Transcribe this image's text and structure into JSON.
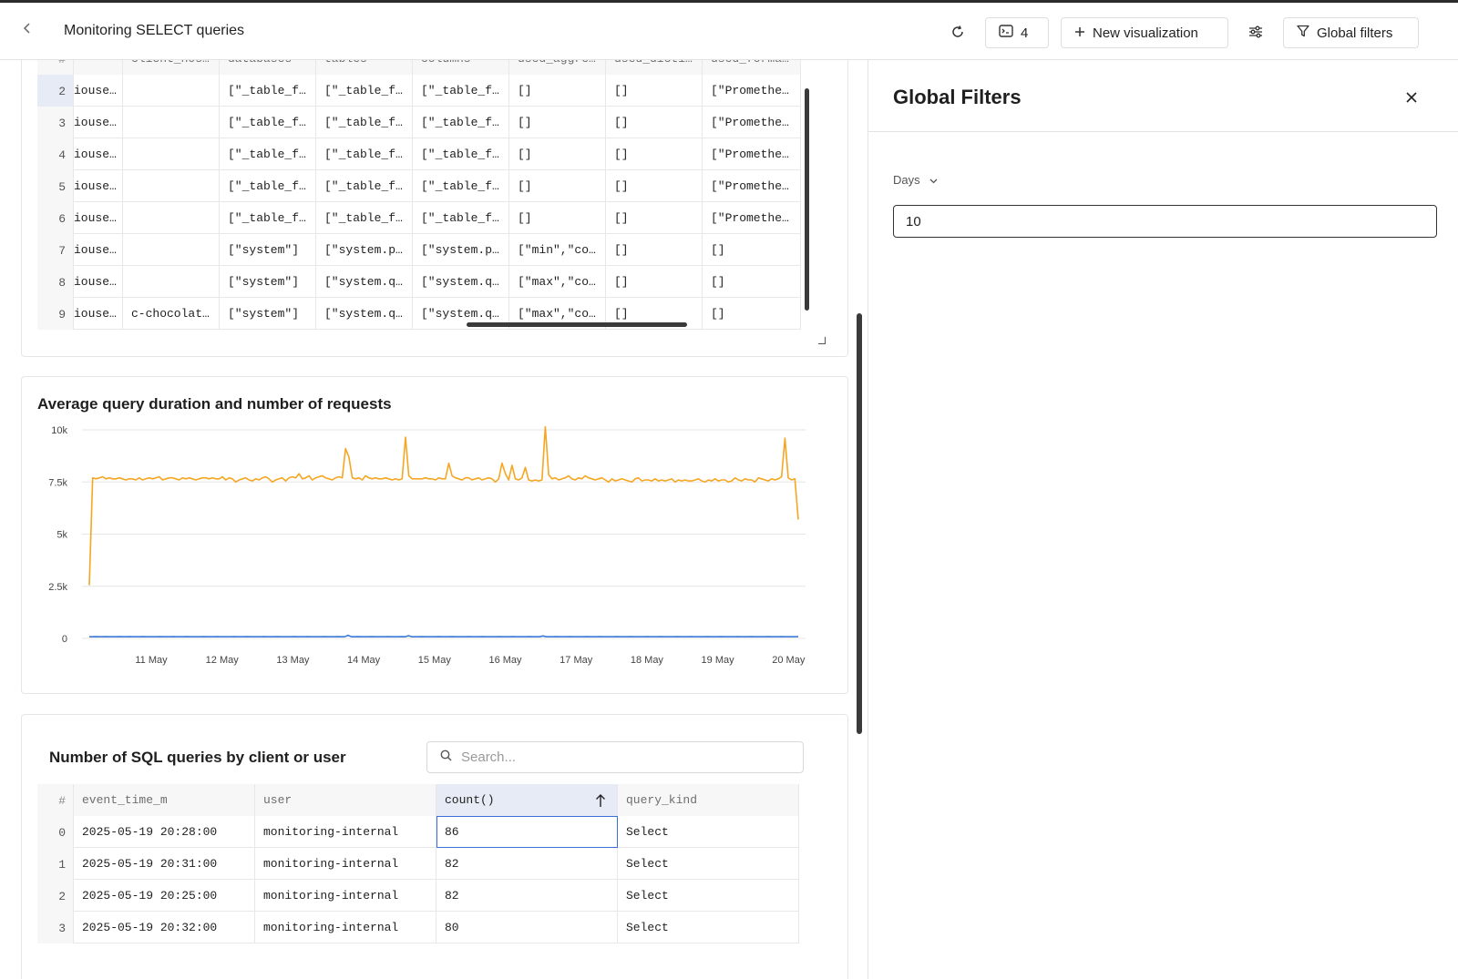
{
  "header": {
    "title": "Monitoring SELECT queries",
    "terminal_count": "4",
    "new_visualization_label": "New visualization",
    "global_filters_label": "Global filters"
  },
  "top_table": {
    "columns": [
      "#",
      "",
      "client_hos…",
      "databases",
      "tables",
      "columns",
      "used_aggre…",
      "used_dicti…",
      "used_forma…"
    ],
    "rows": [
      {
        "n": "2",
        "c1": "iouse…",
        "c2": "",
        "c3": "[\"_table_f…",
        "c4": "[\"_table_f…",
        "c5": "[\"_table_f…",
        "c6": "[]",
        "c7": "[]",
        "c8": "[\"Promethe…"
      },
      {
        "n": "3",
        "c1": "iouse…",
        "c2": "",
        "c3": "[\"_table_f…",
        "c4": "[\"_table_f…",
        "c5": "[\"_table_f…",
        "c6": "[]",
        "c7": "[]",
        "c8": "[\"Promethe…"
      },
      {
        "n": "4",
        "c1": "iouse…",
        "c2": "",
        "c3": "[\"_table_f…",
        "c4": "[\"_table_f…",
        "c5": "[\"_table_f…",
        "c6": "[]",
        "c7": "[]",
        "c8": "[\"Promethe…"
      },
      {
        "n": "5",
        "c1": "iouse…",
        "c2": "",
        "c3": "[\"_table_f…",
        "c4": "[\"_table_f…",
        "c5": "[\"_table_f…",
        "c6": "[]",
        "c7": "[]",
        "c8": "[\"Promethe…"
      },
      {
        "n": "6",
        "c1": "iouse…",
        "c2": "",
        "c3": "[\"_table_f…",
        "c4": "[\"_table_f…",
        "c5": "[\"_table_f…",
        "c6": "[]",
        "c7": "[]",
        "c8": "[\"Promethe…"
      },
      {
        "n": "7",
        "c1": "iouse…",
        "c2": "",
        "c3": "[\"system\"]",
        "c4": "[\"system.p…",
        "c5": "[\"system.p…",
        "c6": "[\"min\",\"co…",
        "c7": "[]",
        "c8": "[]"
      },
      {
        "n": "8",
        "c1": "iouse…",
        "c2": "",
        "c3": "[\"system\"]",
        "c4": "[\"system.q…",
        "c5": "[\"system.q…",
        "c6": "[\"max\",\"co…",
        "c7": "[]",
        "c8": "[]"
      },
      {
        "n": "9",
        "c1": "iouse…",
        "c2": "c-chocolat…",
        "c3": "[\"system\"]",
        "c4": "[\"system.q…",
        "c5": "[\"system.q…",
        "c6": "[\"max\",\"co…",
        "c7": "[]",
        "c8": "[]"
      }
    ]
  },
  "chart": {
    "title": "Average query duration and number of requests"
  },
  "chart_data": {
    "type": "line",
    "title": "Average query duration and number of requests",
    "xlabel": "",
    "ylabel": "",
    "x_ticks": [
      "11 May",
      "12 May",
      "13 May",
      "14 May",
      "15 May",
      "16 May",
      "17 May",
      "18 May",
      "19 May",
      "20 May"
    ],
    "y_ticks": [
      "10k",
      "7.5k",
      "5k",
      "2.5k",
      "0"
    ],
    "ylim": [
      0,
      10000
    ],
    "grid": true,
    "x_start": "2025-05-10 02:00",
    "x_step_hours": 2,
    "series": [
      {
        "color": "#f5a623",
        "values": [
          2550,
          7700,
          7650,
          7700,
          7750,
          7650,
          7700,
          7650,
          7650,
          7700,
          7650,
          7600,
          7650,
          7650,
          7600,
          7700,
          7600,
          7650,
          7700,
          7650,
          7700,
          7750,
          7600,
          7650,
          7700,
          7700,
          7650,
          7600,
          7700,
          7650,
          7700,
          7650,
          7600,
          7650,
          7700,
          7700,
          7650,
          7700,
          7650,
          7650,
          7750,
          7600,
          7700,
          7650,
          7500,
          7600,
          7650,
          7700,
          7600,
          7550,
          7650,
          7600,
          7700,
          7750,
          7650,
          7500,
          7600,
          7650,
          7700,
          7550,
          7700,
          7750,
          7700,
          7900,
          7650,
          7700,
          7800,
          7600,
          7700,
          7750,
          7800,
          7700,
          7650,
          7600,
          7700,
          7750,
          7700,
          9100,
          8700,
          7700,
          7650,
          7700,
          7600,
          7800,
          7700,
          7650,
          7700,
          7650,
          7650,
          7700,
          7650,
          7600,
          7650,
          7600,
          7650,
          9650,
          7800,
          7650,
          7650,
          7650,
          7650,
          7700,
          7650,
          7650,
          7600,
          7700,
          7650,
          7650,
          8400,
          7800,
          7700,
          7650,
          7600,
          7700,
          7700,
          7600,
          7650,
          7700,
          7600,
          7650,
          7700,
          7650,
          7500,
          7650,
          8400,
          7900,
          7600,
          8300,
          7650,
          7600,
          7700,
          8200,
          7600,
          7550,
          7600,
          7550,
          7600,
          10150,
          7850,
          7650,
          7700,
          7600,
          7650,
          7700,
          7800,
          7650,
          7600,
          7700,
          7650,
          7800,
          7700,
          7650,
          7600,
          7650,
          7700,
          7600,
          7500,
          7650,
          7550,
          7600,
          7650,
          7600,
          7550,
          7500,
          7650,
          7700,
          7550,
          7600,
          7600,
          7550,
          7650,
          7550,
          7600,
          7550,
          7600,
          7650,
          7500,
          7600,
          7550,
          7600,
          7550,
          7550,
          7600,
          7650,
          7550,
          7500,
          7600,
          7550,
          7650,
          7550,
          7600,
          7600,
          7500,
          7550,
          7700,
          7600,
          7550,
          7650,
          7600,
          7600,
          7500,
          7700,
          7650,
          7600,
          7550,
          7650,
          7600,
          7650,
          7750,
          9600,
          7700,
          7600,
          7650,
          5700
        ]
      },
      {
        "color": "#3b7ad9",
        "values": [
          80,
          80,
          85,
          80,
          80,
          85,
          80,
          80,
          80,
          85,
          80,
          80,
          85,
          80,
          80,
          80,
          85,
          80,
          80,
          80,
          80,
          85,
          80,
          80,
          80,
          85,
          80,
          80,
          80,
          85,
          80,
          80,
          80,
          80,
          85,
          80,
          80,
          80,
          85,
          80,
          80,
          80,
          80,
          85,
          80,
          80,
          80,
          85,
          80,
          80,
          80,
          80,
          85,
          80,
          80,
          80,
          85,
          80,
          80,
          80,
          80,
          85,
          80,
          80,
          80,
          85,
          80,
          80,
          80,
          80,
          85,
          80,
          80,
          80,
          85,
          80,
          80,
          150,
          80,
          80,
          85,
          80,
          80,
          80,
          85,
          80,
          80,
          80,
          80,
          85,
          80,
          80,
          80,
          85,
          80,
          130,
          80,
          80,
          80,
          85,
          80,
          80,
          80,
          80,
          85,
          80,
          80,
          80,
          85,
          80,
          80,
          80,
          80,
          85,
          80,
          80,
          80,
          85,
          80,
          80,
          80,
          80,
          85,
          80,
          80,
          80,
          85,
          80,
          80,
          80,
          80,
          85,
          80,
          80,
          80,
          120,
          80,
          80,
          80,
          85,
          80,
          80,
          80,
          85,
          80,
          80,
          80,
          80,
          85,
          80,
          80,
          80,
          85,
          80,
          80,
          80,
          80,
          85,
          80,
          80,
          80,
          85,
          80,
          80,
          80,
          80,
          85,
          80,
          80,
          80,
          85,
          80,
          80,
          80,
          80,
          85,
          80,
          80,
          80,
          85,
          80,
          80,
          80,
          80,
          85,
          80,
          80,
          80,
          85,
          80,
          80,
          80,
          80,
          85,
          80,
          80,
          80,
          85,
          80,
          80,
          80,
          80,
          85,
          80,
          80,
          80,
          85,
          80,
          80,
          80,
          80,
          85
        ]
      }
    ]
  },
  "bottom_card": {
    "title": "Number of SQL queries by client or user",
    "search_placeholder": "Search...",
    "columns": [
      "#",
      "event_time_m",
      "user",
      "count()",
      "query_kind"
    ],
    "rows": [
      {
        "n": "0",
        "event_time_m": "2025-05-19 20:28:00",
        "user": "monitoring-internal",
        "count": "86",
        "query_kind": "Select"
      },
      {
        "n": "1",
        "event_time_m": "2025-05-19 20:31:00",
        "user": "monitoring-internal",
        "count": "82",
        "query_kind": "Select"
      },
      {
        "n": "2",
        "event_time_m": "2025-05-19 20:25:00",
        "user": "monitoring-internal",
        "count": "82",
        "query_kind": "Select"
      },
      {
        "n": "3",
        "event_time_m": "2025-05-19 20:32:00",
        "user": "monitoring-internal",
        "count": "80",
        "query_kind": "Select"
      }
    ]
  },
  "global_filters": {
    "title": "Global Filters",
    "filter_label": "Days",
    "filter_value": "10"
  },
  "colors": {
    "accent_line": "#f5a623",
    "secondary_line": "#3b7ad9",
    "selected_cell_border": "#3b6fd4"
  }
}
